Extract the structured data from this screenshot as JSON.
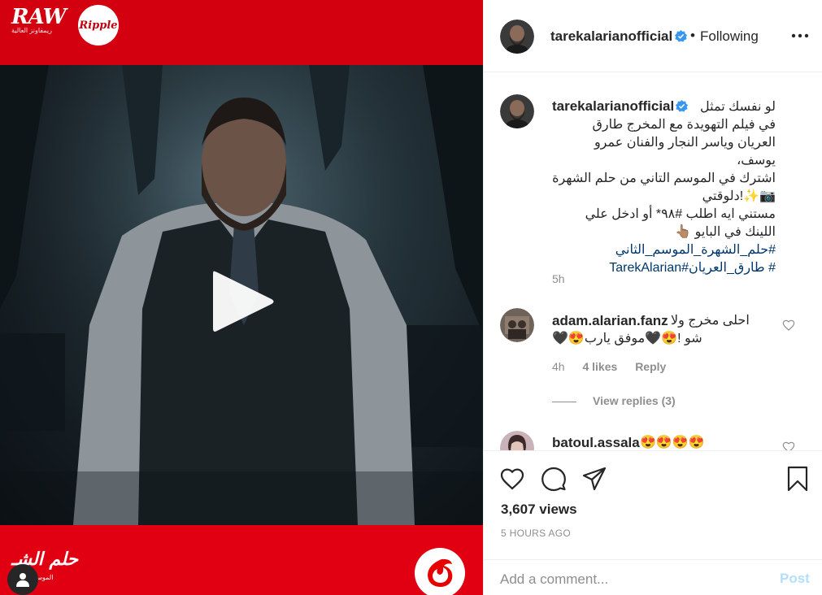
{
  "media": {
    "top_logo_text": "RAW",
    "top_logo_sub": "ريمفاونز العالية",
    "ripple_logo_text": "Ripple",
    "bottom_logo_text": "حلم الشـ",
    "bottom_logo_sub": "الموسم"
  },
  "header": {
    "username": "tarekalarianofficial",
    "separator": "•",
    "follow_state": "Following",
    "more_label": "•••"
  },
  "caption": {
    "username": "tarekalarianofficial",
    "lines": [
      "لو نفسك تمثل",
      "في فيلم التهويدة مع المخرج طارق",
      "العريان وياسر النجار والفنان عمرو يوسف،",
      "اشترك في الموسم التاني من حلم الشهرة",
      "📷✨!دلوقتي",
      "مستني ايه اطلب #٩٨* أو ادخل علي",
      "اللينك في البايو 👆🏽"
    ],
    "hashtags_line1": "#حلم_الشهرة_الموسم_الثاني",
    "hashtags_line2": "# طارق_العريان#TarekAlarian",
    "time": "5h"
  },
  "comment1": {
    "username": "adam.alarian.fanz",
    "text_line1": "احلى مخرج ولا",
    "text_line2": "🖤😍شو !😍🖤موفق يارب",
    "time": "4h",
    "likes": "4 likes",
    "reply": "Reply",
    "view_replies": "View replies (3)"
  },
  "comment2": {
    "username": "batoul.assala",
    "text": "😍😍😍😍"
  },
  "stats": {
    "views": "3,607 views",
    "ago": "5 HOURS AGO"
  },
  "compose": {
    "placeholder": "Add a comment...",
    "post_label": "Post"
  },
  "colors": {
    "brand_red": "#d3000f",
    "verified_blue": "#3897f0",
    "hashtag_blue": "#00376b",
    "post_disabled": "#b2dffc"
  }
}
